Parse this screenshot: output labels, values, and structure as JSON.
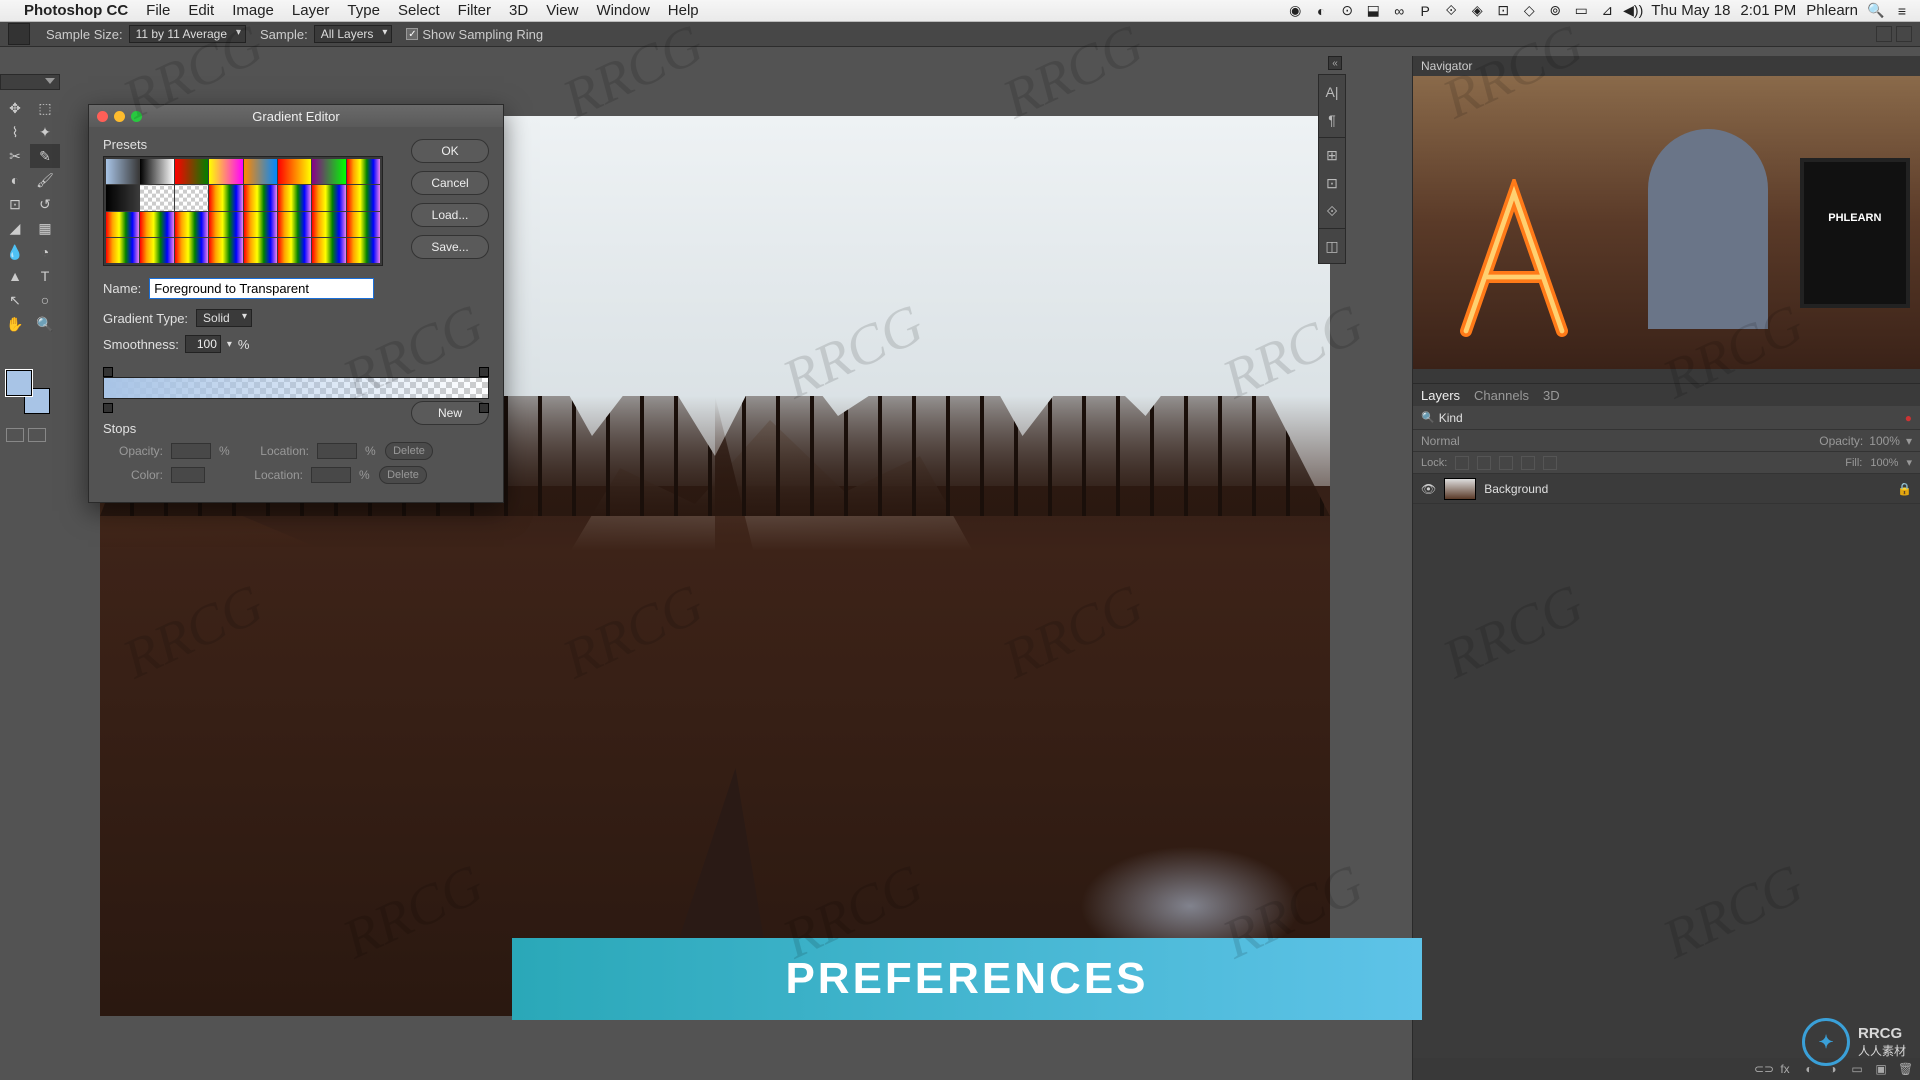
{
  "menubar": {
    "app": "Photoshop CC",
    "items": [
      "File",
      "Edit",
      "Image",
      "Layer",
      "Type",
      "Select",
      "Filter",
      "3D",
      "View",
      "Window",
      "Help"
    ],
    "date": "Thu May 18",
    "time": "2:01 PM",
    "user": "Phlearn"
  },
  "optbar": {
    "sample_size_label": "Sample Size:",
    "sample_size_value": "11 by 11 Average",
    "sample_label": "Sample:",
    "sample_value": "All Layers",
    "show_ring": "Show Sampling Ring"
  },
  "dialog": {
    "title": "Gradient Editor",
    "presets_label": "Presets",
    "ok": "OK",
    "cancel": "Cancel",
    "load": "Load...",
    "save": "Save...",
    "new": "New",
    "name_label": "Name:",
    "name_value": "Foreground to Transparent",
    "gtype_label": "Gradient Type:",
    "gtype_value": "Solid",
    "smooth_label": "Smoothness:",
    "smooth_value": "100",
    "pct": "%",
    "stops_label": "Stops",
    "opacity_label": "Opacity:",
    "color_label": "Color:",
    "location_label": "Location:",
    "delete": "Delete"
  },
  "rightpanels": {
    "navigator": "Navigator",
    "phlearn_logo": "PHLEARN",
    "layers_tab": "Layers",
    "channels_tab": "Channels",
    "threeD_tab": "3D",
    "kind": "Kind",
    "blend": "Normal",
    "opacity_label": "Opacity:",
    "opacity_value": "100%",
    "lock_label": "Lock:",
    "fill_label": "Fill:",
    "fill_value": "100%",
    "layer_name": "Background"
  },
  "banner": "PREFERENCES",
  "watermark": "RRCG",
  "watermark_sub": "人人素材",
  "logo_text": "RRCG",
  "logo_sub": "人人素材"
}
